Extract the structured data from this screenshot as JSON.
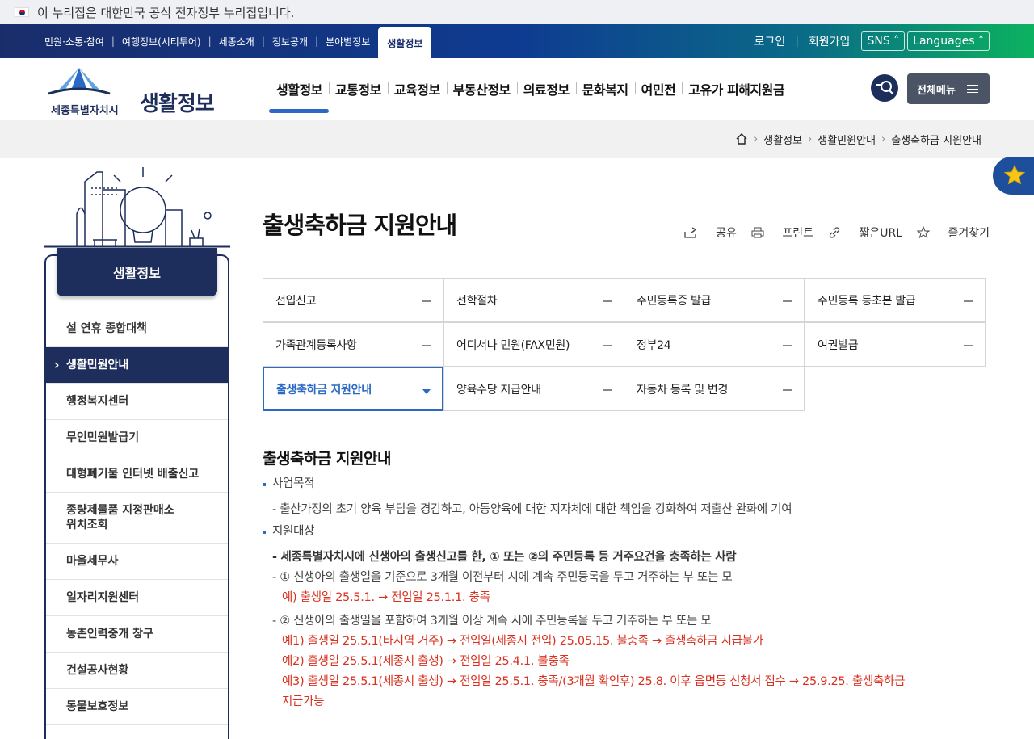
{
  "gov_bar": {
    "text": "이 누리집은 대한민국 공식 전자정부 누리집입니다."
  },
  "util": {
    "links": [
      "민원·소통·참여",
      "여행정보(시티투어)",
      "세종소개",
      "정보공개",
      "분야별정보"
    ],
    "current": "생활정보",
    "login": "로그인",
    "join": "회원가입",
    "sns": "SNS",
    "languages": "Languages"
  },
  "logo": {
    "brand": "생활정보",
    "city": "세종특별자치시"
  },
  "gnb": [
    "생활정보",
    "교통정보",
    "교육정보",
    "부동산정보",
    "의료정보",
    "문화복지",
    "여민전",
    "고유가 피해지원금"
  ],
  "header": {
    "menu_label": "전체메뉴"
  },
  "breadcrumb": [
    "생활정보",
    "생활민원안내",
    "출생축하금 지원안내"
  ],
  "sidebar": {
    "title": "생활정보",
    "items": [
      "설 연휴 종합대책",
      "생활민원안내",
      "행정복지센터",
      "무인민원발급기",
      "대형폐기물 인터넷 배출신고",
      "종량제물품 지정판매소\n위치조회",
      "마을세무사",
      "일자리지원센터",
      "농촌인력중개 창구",
      "건설공사현황",
      "동물보호정보"
    ],
    "active_index": 1
  },
  "page": {
    "title": "출생축하금 지원안내"
  },
  "tools": {
    "share": "공유",
    "print": "프린트",
    "short_url": "짧은URL",
    "bookmark": "즐겨찾기"
  },
  "tabs": [
    "전입신고",
    "전학절차",
    "주민등록증 발급",
    "주민등록 등초본 발급",
    "가족관계등록사항",
    "어디서나 민원(FAX민원)",
    "정부24",
    "여권발급",
    "출생축하금 지원안내",
    "양육수당 지급안내",
    "자동차 등록 및 변경"
  ],
  "content": {
    "section_title": "출생축하금 지원안내",
    "purpose_label": "사업목적",
    "purpose_desc": "- 출산가정의 초기 양육 부담을 경감하고, 아동양육에 대한 지자체에 대한 책임을 강화하여 저출산 완화에 기여",
    "target_label": "지원대상",
    "target_main": "- 세종특별자치시에 신생아의 출생신고를 한, ① 또는 ②의 주민등록 등 거주요건을 충족하는 사람",
    "cond1": "- ① 신생아의 출생일을 기준으로 3개월 이전부터 시에 계속 주민등록을 두고 거주하는 부 또는 모",
    "cond1_ex": "예) 출생일 25.5.1. → 전입일 25.1.1. 충족",
    "cond2": "- ② 신생아의 출생일을 포함하여 3개월 이상 계속 시에 주민등록을 두고 거주하는 부 또는 모",
    "cond2_ex1": "예1) 출생일 25.5.1(타지역 거주) → 전입일(세종시 전입) 25.05.15. 불충족 → 출생축하금 지급불가",
    "cond2_ex2": "예2) 출생일 25.5.1(세종시 출생) → 전입일 25.4.1. 불충족",
    "cond2_ex3a": "예3) 출생일 25.5.1(세종시 출생) → 전입일 25.5.1. 충족/(3개월 확인후) 25.8. 이후 읍면동 신청서 접수 → 25.9.25. 출생축하금",
    "cond2_ex3b": "지급가능"
  }
}
